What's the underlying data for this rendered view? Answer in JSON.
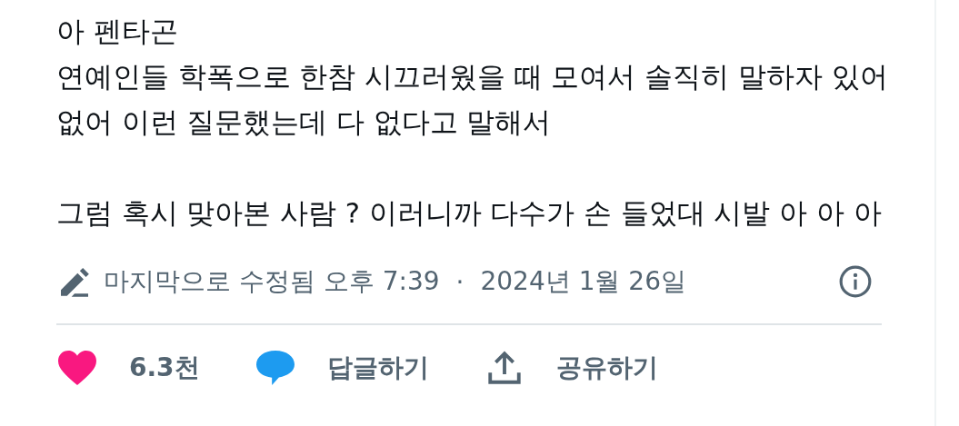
{
  "post": {
    "paragraphs": [
      [
        "아 펜타곤",
        "연예인들 학폭으로 한참 시끄러웠을 때 모여서 솔직히 말하자 있어",
        "없어 이런 질문했는데 다 없다고 말해서"
      ],
      [
        "그럼 혹시 맞아본 사람 ? 이러니까 다수가 손 들었대 시발 아 아 아"
      ]
    ],
    "edited": "마지막으로 수정됨 오후 7:39",
    "separator": "·",
    "date": "2024년 1월 26일"
  },
  "actions": [
    {
      "kind": "like",
      "label": "6.3천",
      "liked": true
    },
    {
      "kind": "reply",
      "label": "답글하기"
    },
    {
      "kind": "share",
      "label": "공유하기"
    }
  ]
}
